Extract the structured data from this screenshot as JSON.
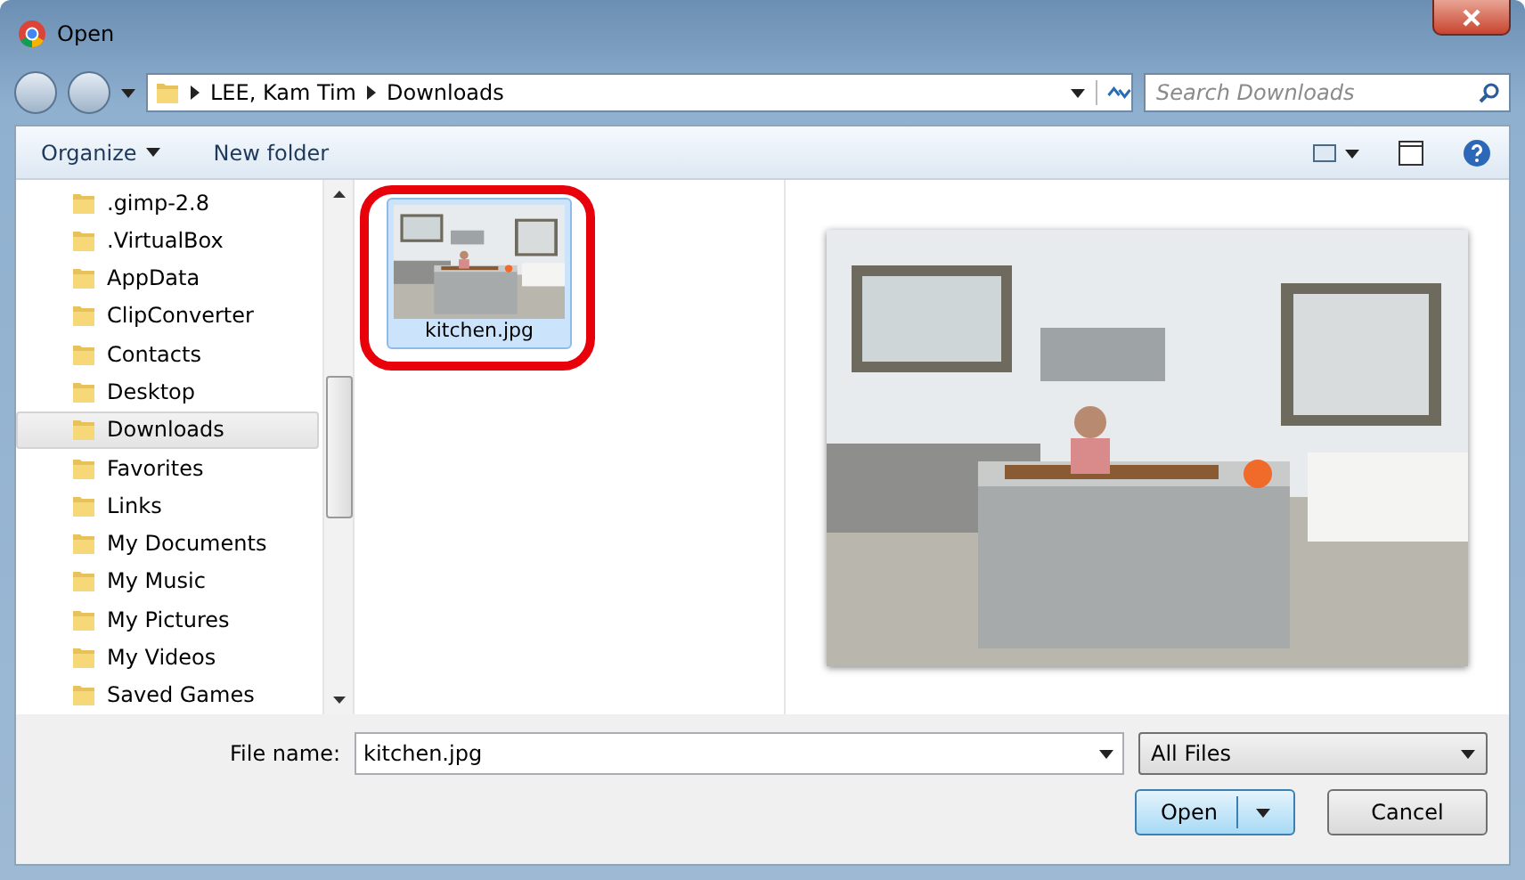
{
  "window": {
    "title": "Open"
  },
  "address": {
    "path": [
      "LEE, Kam Tim",
      "Downloads"
    ]
  },
  "search": {
    "placeholder": "Search Downloads"
  },
  "toolbar": [
    {
      "label": "Organize",
      "dropdown": true
    },
    {
      "label": "New folder",
      "dropdown": false
    }
  ],
  "sidebar": {
    "items": [
      {
        "label": ".gimp-2.8",
        "selected": false
      },
      {
        "label": ".VirtualBox",
        "selected": false
      },
      {
        "label": "AppData",
        "selected": false
      },
      {
        "label": "ClipConverter",
        "selected": false
      },
      {
        "label": "Contacts",
        "selected": false
      },
      {
        "label": "Desktop",
        "selected": false
      },
      {
        "label": "Downloads",
        "selected": true
      },
      {
        "label": "Favorites",
        "selected": false
      },
      {
        "label": "Links",
        "selected": false
      },
      {
        "label": "My Documents",
        "selected": false
      },
      {
        "label": "My Music",
        "selected": false
      },
      {
        "label": "My Pictures",
        "selected": false
      },
      {
        "label": "My Videos",
        "selected": false
      },
      {
        "label": "Saved Games",
        "selected": false
      }
    ]
  },
  "files": [
    {
      "name": "kitchen.jpg",
      "selected": true,
      "circled": true
    }
  ],
  "file_name": {
    "label": "File name:",
    "value": "kitchen.jpg"
  },
  "file_type": {
    "value": "All Files"
  },
  "buttons": [
    {
      "label": "Open",
      "split": true,
      "default": true
    },
    {
      "label": "Cancel",
      "split": false,
      "default": false
    }
  ]
}
